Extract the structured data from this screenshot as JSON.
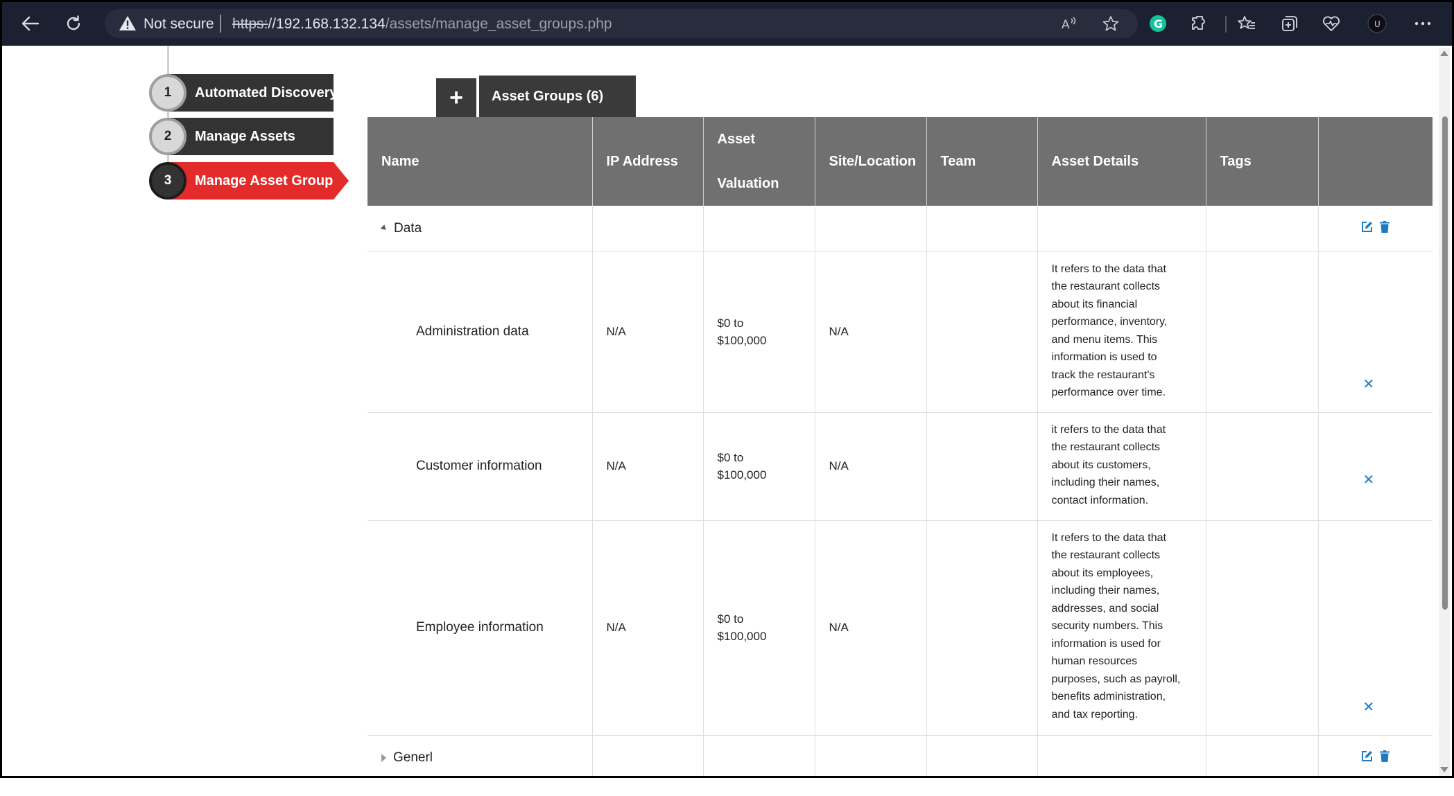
{
  "browser": {
    "warning_label": "Not secure",
    "url_scheme": "https:",
    "url_host": "//192.168.132.134",
    "url_path": "/assets/manage_asset_groups.php",
    "profile_initial": "U",
    "extension_initial": "G"
  },
  "steps": [
    {
      "num": "1",
      "label": "Automated Discovery",
      "active": false
    },
    {
      "num": "2",
      "label": "Manage Assets",
      "active": false
    },
    {
      "num": "3",
      "label": "Manage Asset Groups",
      "active": true
    }
  ],
  "tabs": {
    "add_label": "+",
    "groups_label": "Asset Groups (6)"
  },
  "table": {
    "headers": {
      "name": "Name",
      "ip": "IP Address",
      "valuation_line1": "Asset",
      "valuation_line2": "Valuation",
      "site": "Site/Location",
      "team": "Team",
      "details": "Asset Details",
      "tags": "Tags"
    },
    "groups": [
      {
        "name": "Data",
        "expanded": true,
        "assets": [
          {
            "name": "Administration data",
            "ip": "N/A",
            "valuation_line1": "$0 to",
            "valuation_line2": "$100,000",
            "site": "N/A",
            "team": "",
            "details_lines": [
              "It refers to the data that",
              "the restaurant collects",
              "about its financial",
              "performance, inventory,",
              "and menu items. This",
              "information is used to",
              "track the restaurant's",
              "performance over time."
            ],
            "tags": ""
          },
          {
            "name": "Customer information",
            "ip": "N/A",
            "valuation_line1": "$0 to",
            "valuation_line2": "$100,000",
            "site": "N/A",
            "team": "",
            "details_lines": [
              "it refers to the data that",
              "the restaurant collects",
              "about its customers,",
              "including their names,",
              "contact information."
            ],
            "tags": ""
          },
          {
            "name": "Employee information",
            "ip": "N/A",
            "valuation_line1": "$0 to",
            "valuation_line2": "$100,000",
            "site": "N/A",
            "team": "",
            "details_lines": [
              "It refers to the data that",
              "the restaurant collects",
              "about its employees,",
              "including their names,",
              "addresses, and social",
              "security numbers. This",
              "information is used for",
              "human resources",
              "purposes, such as payroll,",
              "benefits administration,",
              "and tax reporting."
            ],
            "tags": ""
          }
        ]
      },
      {
        "name": "Generl",
        "expanded": false,
        "assets": []
      }
    ]
  },
  "colors": {
    "active_step": "#e32b2b",
    "header_bg": "#707070",
    "icon_blue": "#1a7bc7",
    "browser_bg": "#1b2130"
  },
  "icons": [
    "back-arrow-icon",
    "reload-icon",
    "warning-icon",
    "read-aloud-icon",
    "favorite-star-icon",
    "grammarly-icon",
    "extensions-icon",
    "favorites-icon",
    "collections-icon",
    "browser-essentials-icon",
    "profile-icon",
    "more-icon",
    "edit-icon",
    "trash-icon",
    "remove-x-icon",
    "caret-down-icon",
    "caret-right-icon"
  ]
}
